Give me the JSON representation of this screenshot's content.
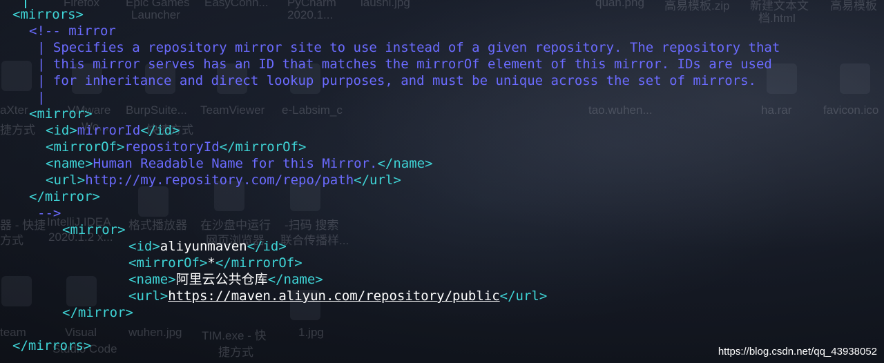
{
  "desktop": {
    "ghost_labels": [
      "Firefox",
      "Epic Games",
      "Launcher",
      "EasyConn...",
      "PyCharm",
      "2020.1...",
      "laushi.jpg",
      "quan.png",
      "高易模板.zip",
      "新建文本文",
      "档.html",
      "高易模板",
      "aXter",
      "VMware",
      "BurpSuite...",
      "TeamViewer",
      "e-Labsim_c",
      "tao.wuhen...",
      "ha.rar",
      "favicon.ico",
      "捷方式",
      "Wo...",
      "快捷方式",
      "器 - 快捷",
      "IntelliJ IDEA",
      "2020.1.2 x...",
      "格式播放器",
      "在沙盘中运行",
      "网页浏览器",
      "-扫码 搜索",
      "联合传播样...",
      "方式",
      "team",
      "Visual",
      "Studio Code",
      "wuhen.jpg",
      "TIM.exe - 快",
      "捷方式",
      "1.jpg"
    ]
  },
  "editor": {
    "lines": [
      {
        "indent": "",
        "segments": [
          {
            "cls": "tag",
            "text": "<mirrors>"
          }
        ]
      },
      {
        "indent": "  ",
        "segments": [
          {
            "cls": "cmt",
            "text": "<!-- mirror"
          }
        ]
      },
      {
        "indent": "   ",
        "segments": [
          {
            "cls": "cmt",
            "text": "| Specifies a repository mirror site to use instead of a given repository. The repository that"
          }
        ]
      },
      {
        "indent": "   ",
        "segments": [
          {
            "cls": "cmt",
            "text": "| this mirror serves has an ID that matches the mirrorOf element of this mirror. IDs are used"
          }
        ]
      },
      {
        "indent": "   ",
        "segments": [
          {
            "cls": "cmt",
            "text": "| for inheritance and direct lookup purposes, and must be unique across the set of mirrors."
          }
        ]
      },
      {
        "indent": "   ",
        "segments": [
          {
            "cls": "cmt",
            "text": "|"
          }
        ]
      },
      {
        "indent": "  ",
        "segments": [
          {
            "cls": "tag",
            "text": "<mirror>"
          }
        ]
      },
      {
        "indent": "    ",
        "segments": [
          {
            "cls": "tag",
            "text": "<id>"
          },
          {
            "cls": "cmt",
            "text": "mirrorId"
          },
          {
            "cls": "tag",
            "text": "</id>"
          }
        ]
      },
      {
        "indent": "    ",
        "segments": [
          {
            "cls": "tag",
            "text": "<mirrorOf>"
          },
          {
            "cls": "cmt",
            "text": "repositoryId"
          },
          {
            "cls": "tag",
            "text": "</mirrorOf>"
          }
        ]
      },
      {
        "indent": "    ",
        "segments": [
          {
            "cls": "tag",
            "text": "<name>"
          },
          {
            "cls": "cmt",
            "text": "Human Readable Name for this Mirror."
          },
          {
            "cls": "tag",
            "text": "</name>"
          }
        ]
      },
      {
        "indent": "    ",
        "segments": [
          {
            "cls": "tag",
            "text": "<url>"
          },
          {
            "cls": "cmt",
            "text": "http://my.repository.com/repo/path"
          },
          {
            "cls": "tag",
            "text": "</url>"
          }
        ]
      },
      {
        "indent": "  ",
        "segments": [
          {
            "cls": "tag",
            "text": "</mirror>"
          }
        ]
      },
      {
        "indent": "   ",
        "segments": [
          {
            "cls": "cmt",
            "text": "-->"
          }
        ]
      },
      {
        "indent": "      ",
        "segments": [
          {
            "cls": "tag",
            "text": "<mirror>"
          }
        ]
      },
      {
        "indent": "              ",
        "segments": [
          {
            "cls": "tag",
            "text": "<id>"
          },
          {
            "cls": "txt",
            "text": "aliyunmaven"
          },
          {
            "cls": "tag",
            "text": "</id>"
          }
        ]
      },
      {
        "indent": "              ",
        "segments": [
          {
            "cls": "tag",
            "text": "<mirrorOf>"
          },
          {
            "cls": "txt",
            "text": "*"
          },
          {
            "cls": "tag",
            "text": "</mirrorOf>"
          }
        ]
      },
      {
        "indent": "              ",
        "segments": [
          {
            "cls": "tag",
            "text": "<name>"
          },
          {
            "cls": "txt",
            "text": "阿里云公共仓库"
          },
          {
            "cls": "tag",
            "text": "</name>"
          }
        ]
      },
      {
        "indent": "              ",
        "segments": [
          {
            "cls": "tag",
            "text": "<url>"
          },
          {
            "cls": "url",
            "text": "https://maven.aliyun.com/repository/public"
          },
          {
            "cls": "tag",
            "text": "</url>"
          }
        ]
      },
      {
        "indent": "      ",
        "segments": [
          {
            "cls": "tag",
            "text": "</mirror>"
          }
        ]
      },
      {
        "indent": "",
        "segments": [
          {
            "cls": "txt",
            "text": ""
          }
        ]
      },
      {
        "indent": "",
        "segments": [
          {
            "cls": "tag",
            "text": "</mirrors>"
          }
        ]
      }
    ]
  },
  "watermark": "https://blog.csdn.net/qq_43938052"
}
